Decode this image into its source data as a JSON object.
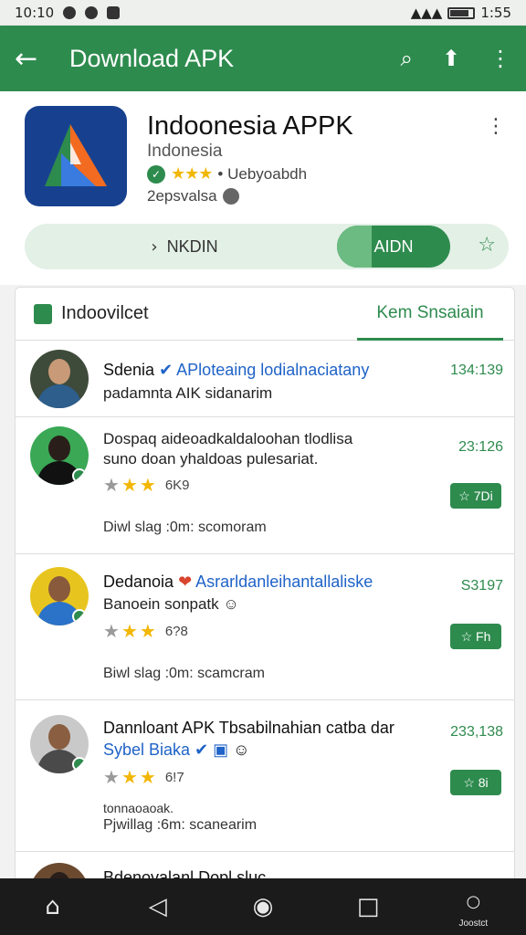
{
  "status_bar": {
    "time": "10:10",
    "right_time": "1:55"
  },
  "app_bar": {
    "title": "Download APK"
  },
  "app": {
    "name": "Indoonesia APPK",
    "subtitle": "Indonesia",
    "rating_label": "• Uebyoabdh",
    "developer": "2epsvalsa",
    "left_button": "NKDIN",
    "green_button": "AIDN"
  },
  "tabs": {
    "left": "Indoovilcet",
    "right": "Kem Snsaiain"
  },
  "reviews": [
    {
      "name": "Sdenia",
      "verified_text": "APloteaing lodialnaciatany",
      "line1": "padamnta AIK sidanarim",
      "line2": "",
      "star_count": "",
      "meta": "",
      "count": "134:139",
      "button": ""
    },
    {
      "name": "",
      "verified_text": "",
      "line1": "Dospaq aideoadkaldaloohan tlodlisa",
      "line2": "suno doan yhaldoas pulesariat.",
      "star_count": "6K9",
      "meta": "Diwl slag :0m: scomoram",
      "count": "23:126",
      "button": "☆ 7Di"
    },
    {
      "name": "Dedanoia",
      "verified_text": "Asrarldanleihantallaliske",
      "line1": "Banoein sonpatk",
      "line2": "",
      "star_count": "6?8",
      "meta": "Biwl slag :0m: scamcram",
      "count": "S3197",
      "button": "☆ Fh"
    },
    {
      "name": "Dannloant APK Tbsabilnahian catba dar",
      "verified_text": "Sybel Biaka",
      "line1": "",
      "line2": "tonnaoaoak.",
      "star_count": "6!7",
      "meta": "Pjwillag :6m: scanearim",
      "count": "233,138",
      "button": "☆ 8i"
    },
    {
      "name": "Bdenovalanl Dopl sluc",
      "verified_text": "",
      "line1": "",
      "line2": "",
      "star_count": "",
      "meta": "",
      "count": "",
      "button": ""
    }
  ],
  "nav": {
    "recent_label": "Joostct"
  },
  "colors": {
    "brand_green": "#2e8b4e",
    "star_yellow": "#f2b705",
    "link_blue": "#1f63c8"
  }
}
